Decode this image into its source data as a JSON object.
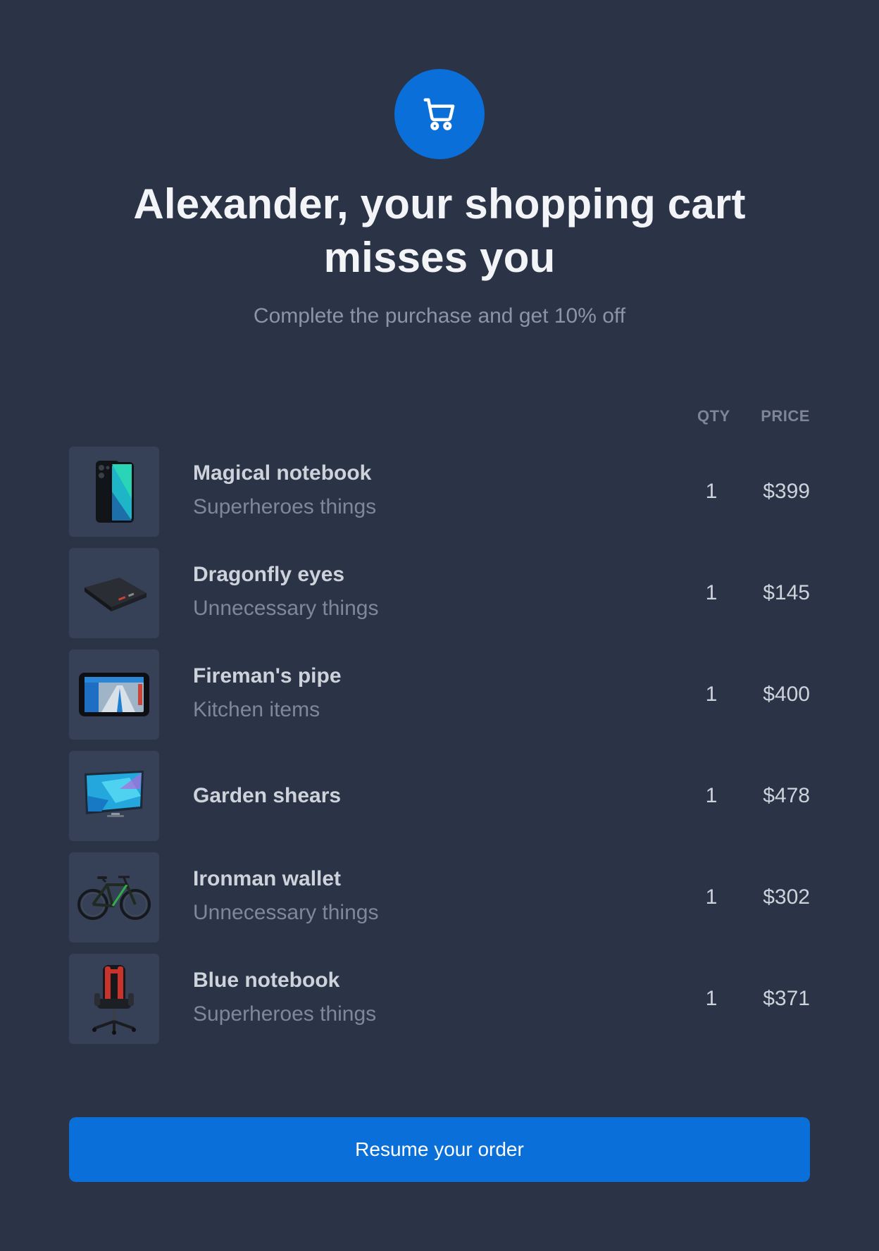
{
  "header": {
    "icon": "shopping-cart-icon",
    "title": "Alexander, your shopping cart misses you",
    "subtitle": "Complete the purchase and get 10% off"
  },
  "columns": {
    "qty": "QTY",
    "price": "PRICE"
  },
  "items": [
    {
      "name": "Magical notebook",
      "category": "Superheroes things",
      "qty": "1",
      "price": "$399",
      "image": "smartphone-image"
    },
    {
      "name": "Dragonfly eyes",
      "category": "Unnecessary things",
      "qty": "1",
      "price": "$145",
      "image": "power-bank-image"
    },
    {
      "name": "Fireman's pipe",
      "category": "Kitchen items",
      "qty": "1",
      "price": "$400",
      "image": "gps-navigator-image"
    },
    {
      "name": "Garden shears",
      "category": "",
      "qty": "1",
      "price": "$478",
      "image": "television-image"
    },
    {
      "name": "Ironman wallet",
      "category": "Unnecessary things",
      "qty": "1",
      "price": "$302",
      "image": "bicycle-image"
    },
    {
      "name": "Blue notebook",
      "category": "Superheroes things",
      "qty": "1",
      "price": "$371",
      "image": "gaming-chair-image"
    }
  ],
  "cta": {
    "label": "Resume your order"
  },
  "colors": {
    "background": "#2b3446",
    "accent": "#0a6fd9"
  }
}
